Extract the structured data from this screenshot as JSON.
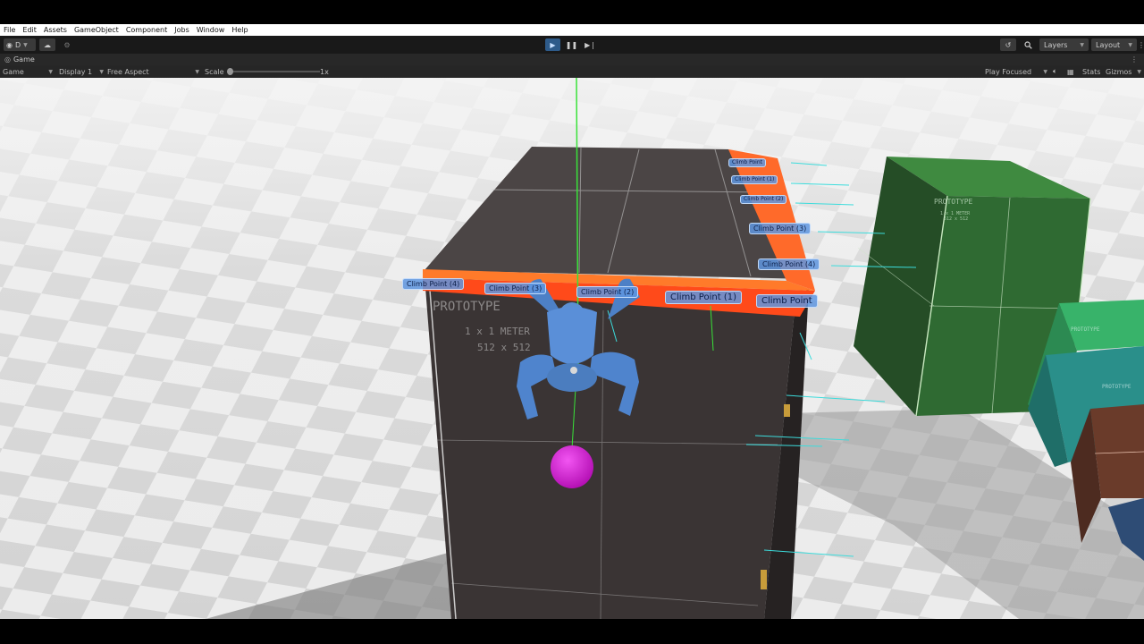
{
  "menu": [
    "File",
    "Edit",
    "Assets",
    "GameObject",
    "Component",
    "Jobs",
    "Window",
    "Help"
  ],
  "toolbar": {
    "account_label": "D",
    "layers_label": "Layers",
    "layout_label": "Layout"
  },
  "tab": {
    "label": "Game"
  },
  "game_bar": {
    "view_mode": "Game",
    "display": "Display 1",
    "aspect": "Free Aspect",
    "scale_label": "Scale",
    "scale_value": "1x",
    "play_mode": "Play Focused",
    "stats": "Stats",
    "gizmos": "Gizmos"
  },
  "scene": {
    "climb_points": [
      "Climb Point",
      "Climb Point (1)",
      "Climb Point (2)",
      "Climb Point (3)",
      "Climb Point (4)",
      "Climb Point (4)",
      "Climb Point (3)",
      "Climb Point (2)",
      "Climb Point (1)",
      "Climb Point"
    ],
    "prototype_text": [
      "PROTOTYPE",
      "1 x 1 METER",
      "512 x 512"
    ],
    "colors": {
      "ledge": "#ff4a1a",
      "climb_label": "#5f96e1",
      "target_sphere": "#d21ad2",
      "dark_box": "#3a3434",
      "green_box": "#2f6a32"
    }
  }
}
